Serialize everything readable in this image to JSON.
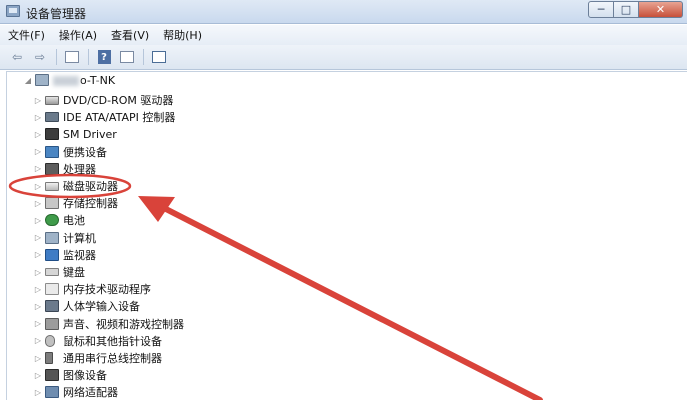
{
  "window": {
    "title": "设备管理器",
    "buttons": {
      "minimize": "─",
      "maximize": "□",
      "close": "✕"
    }
  },
  "menu": [
    "文件(F)",
    "操作(A)",
    "查看(V)",
    "帮助(H)"
  ],
  "toolbar": {
    "back_icon": "⇦",
    "forward_icon": "⇨",
    "help_label": "?"
  },
  "tree": {
    "root": {
      "name_visible": "o-T",
      "name_suffix": "NK",
      "expander": "◢"
    },
    "expander_glyph": "▷",
    "items": [
      {
        "label": "DVD/CD-ROM 驱动器",
        "icon": "dvd-drive-icon"
      },
      {
        "label": "IDE ATA/ATAPI 控制器",
        "icon": "ide-controller-icon"
      },
      {
        "label": "SM Driver",
        "icon": "chip-icon"
      },
      {
        "label": "便携设备",
        "icon": "portable-device-icon"
      },
      {
        "label": "处理器",
        "icon": "processor-icon"
      },
      {
        "label": "磁盘驱动器",
        "icon": "disk-drive-icon"
      },
      {
        "label": "存储控制器",
        "icon": "storage-controller-icon"
      },
      {
        "label": "电池",
        "icon": "battery-icon"
      },
      {
        "label": "计算机",
        "icon": "computer-icon"
      },
      {
        "label": "监视器",
        "icon": "monitor-icon"
      },
      {
        "label": "键盘",
        "icon": "keyboard-icon"
      },
      {
        "label": "内存技术驱动程序",
        "icon": "memory-icon"
      },
      {
        "label": "人体学输入设备",
        "icon": "hid-icon"
      },
      {
        "label": "声音、视频和游戏控制器",
        "icon": "sound-icon"
      },
      {
        "label": "鼠标和其他指针设备",
        "icon": "mouse-icon"
      },
      {
        "label": "通用串行总线控制器",
        "icon": "usb-icon"
      },
      {
        "label": "图像设备",
        "icon": "imaging-device-icon"
      },
      {
        "label": "网络适配器",
        "icon": "network-adapter-icon"
      }
    ]
  },
  "annotation": {
    "color": "#d9433a",
    "highlighted_item": "磁盘驱动器"
  }
}
